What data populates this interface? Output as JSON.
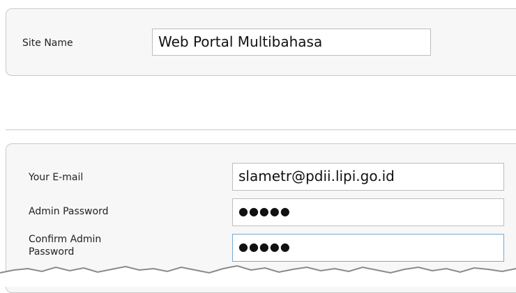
{
  "site": {
    "name_label": "Site Name",
    "name_value": "Web Portal Multibahasa"
  },
  "admin": {
    "email_label": "Your E-mail",
    "email_value": "slametr@pdii.lipi.go.id",
    "password_label": "Admin Password",
    "password_value": "●●●●●",
    "confirm_label_line1": "Confirm Admin",
    "confirm_label_line2": "Password",
    "confirm_value": "●●●●●"
  }
}
